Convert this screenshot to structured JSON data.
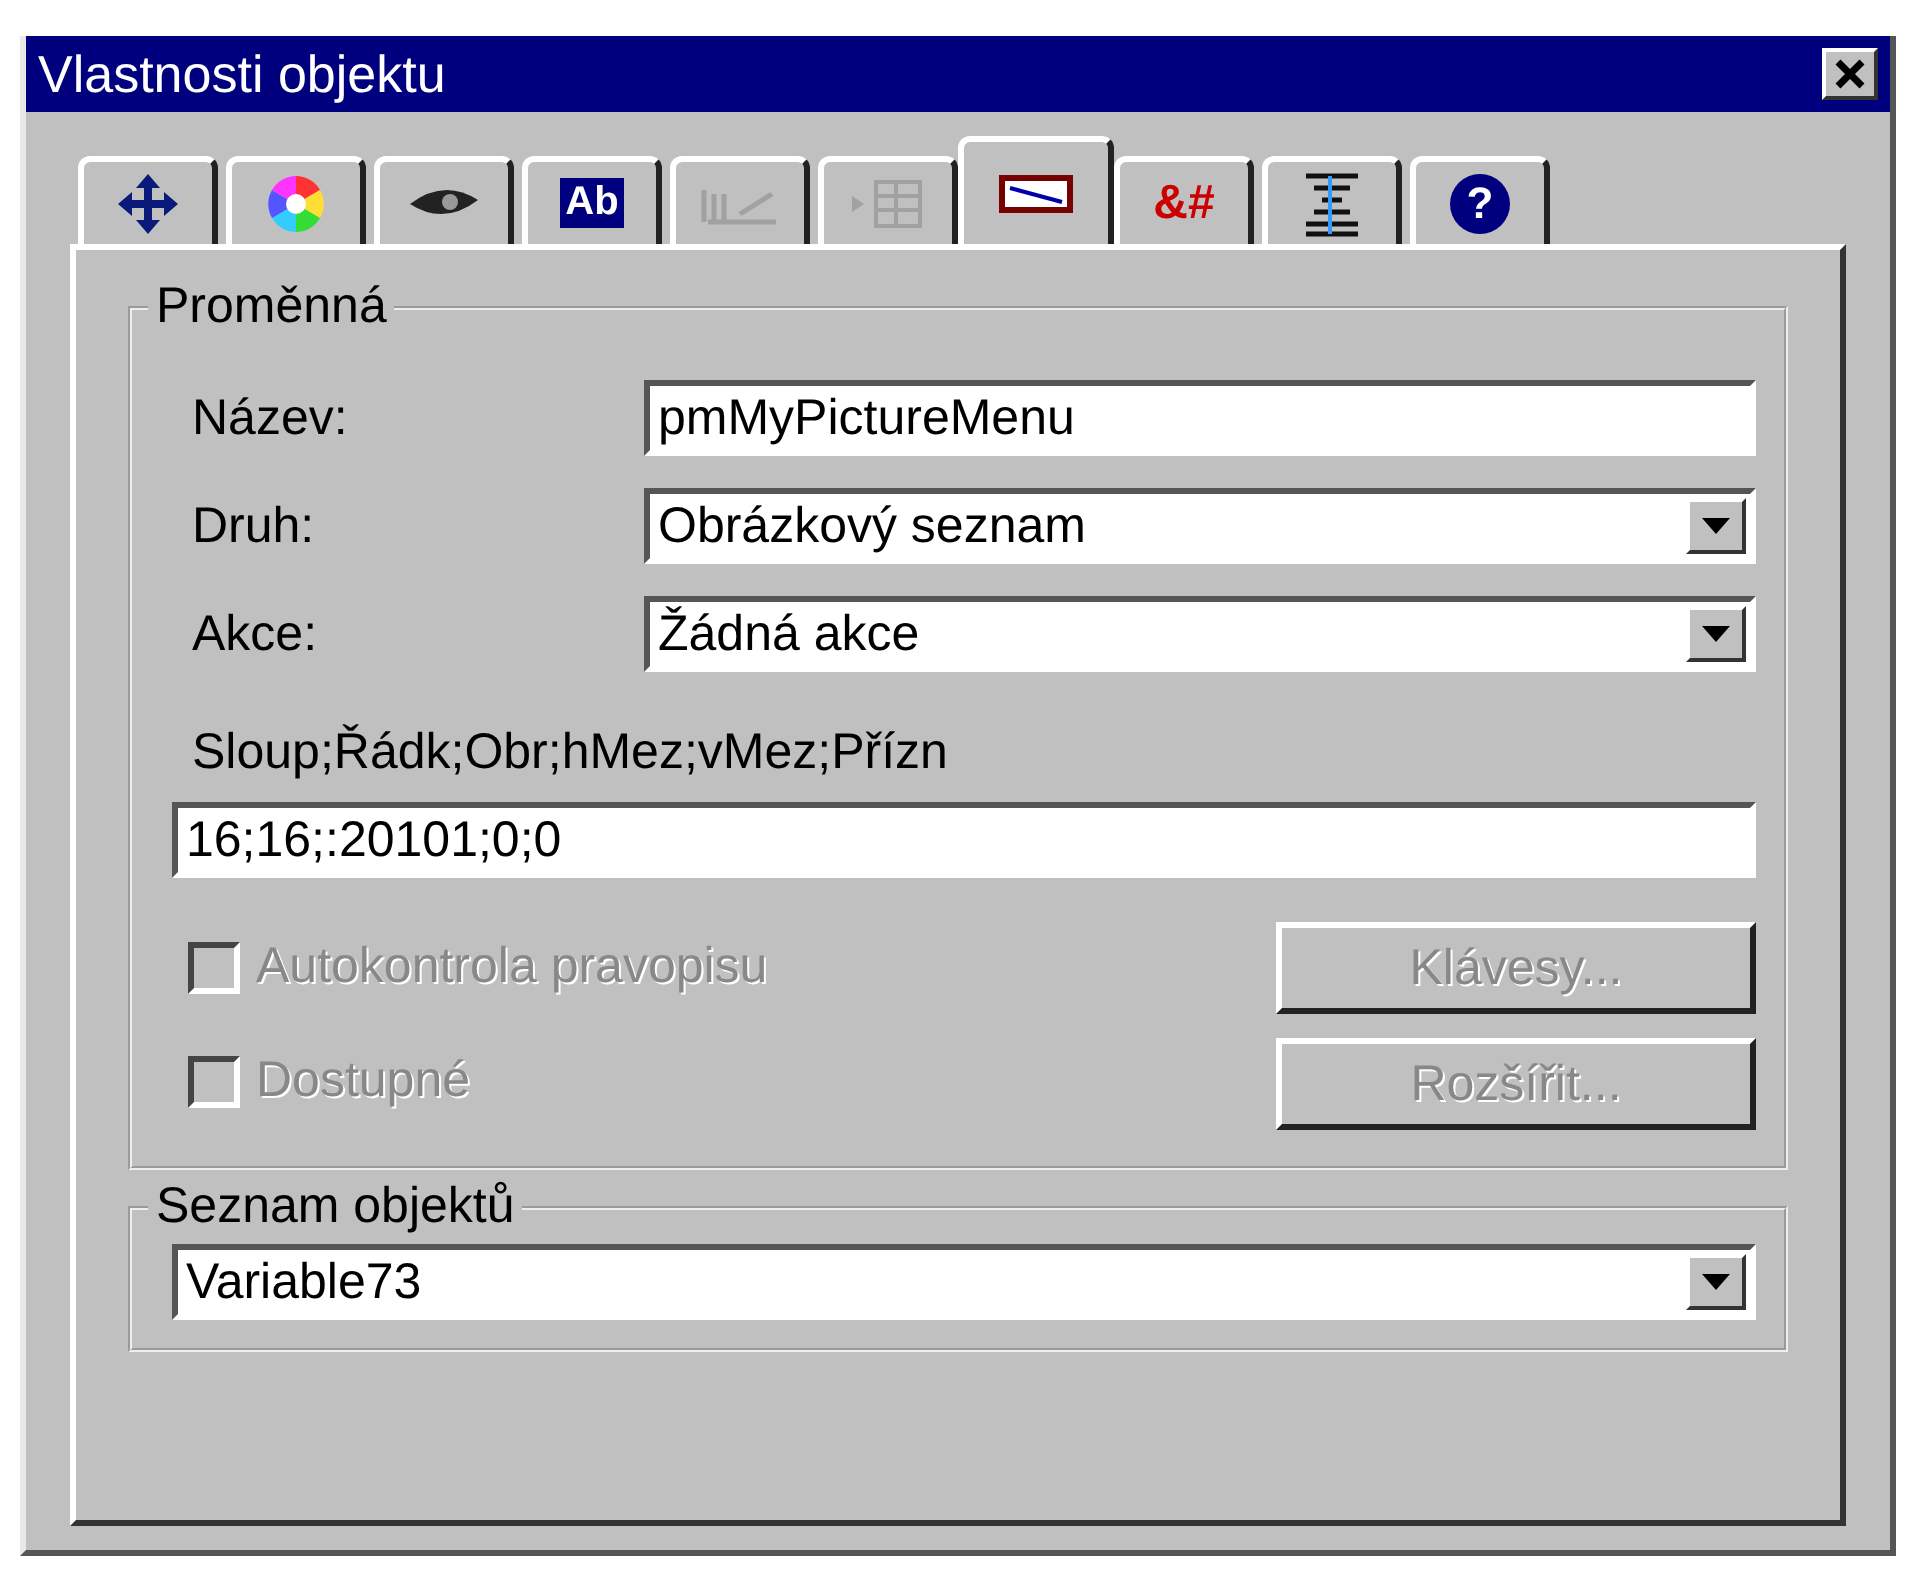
{
  "window": {
    "title": "Vlastnosti objektu"
  },
  "tabs": [
    {
      "kind": "move",
      "selected": false,
      "disabled": false
    },
    {
      "kind": "color",
      "selected": false,
      "disabled": false
    },
    {
      "kind": "eye",
      "selected": false,
      "disabled": false
    },
    {
      "kind": "text",
      "glyph": "Ab",
      "selected": false,
      "disabled": false
    },
    {
      "kind": "ruler",
      "selected": false,
      "disabled": true
    },
    {
      "kind": "table",
      "selected": false,
      "disabled": true
    },
    {
      "kind": "picture",
      "selected": true,
      "disabled": false
    },
    {
      "kind": "text",
      "glyph": "&#",
      "selected": false,
      "disabled": false
    },
    {
      "kind": "list",
      "selected": false,
      "disabled": false
    },
    {
      "kind": "help",
      "glyph": "?",
      "selected": false,
      "disabled": false
    }
  ],
  "variable_group": {
    "title": "Proměnná",
    "fields": [
      {
        "kind": "text",
        "label": "Název:",
        "value": "pmMyPictureMenu"
      },
      {
        "kind": "dropdown",
        "label": "Druh:",
        "value": "Obrázkový seznam"
      },
      {
        "kind": "dropdown",
        "label": "Akce:",
        "value": "Žádná akce"
      }
    ],
    "params_label": "Sloup;Řádk;Obr;hMez;vMez;Přízn",
    "params_value": "16;16;:20101;0;0",
    "checkboxes": [
      {
        "label": "Autokontrola pravopisu",
        "checked": false,
        "disabled": true
      },
      {
        "label": "Dostupné",
        "checked": false,
        "disabled": true
      }
    ],
    "buttons": [
      {
        "label": "Klávesy...",
        "disabled": true
      },
      {
        "label": "Rozšířit...",
        "disabled": true
      }
    ]
  },
  "object_list": {
    "title": "Seznam objektů",
    "value": "Variable73"
  }
}
